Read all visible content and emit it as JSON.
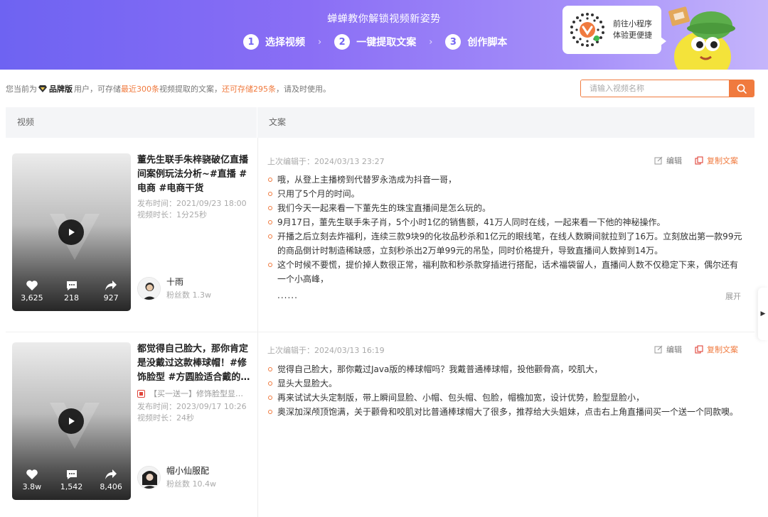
{
  "banner": {
    "title": "蝉蝉教你解锁视频新姿势",
    "steps": [
      {
        "num": "1",
        "label": "选择视频"
      },
      {
        "num": "2",
        "label": "一键提取文案"
      },
      {
        "num": "3",
        "label": "创作脚本"
      }
    ],
    "arrow": "›",
    "qr_line1": "前往小程序",
    "qr_line2": "体验更便捷",
    "accent": "#7566f3"
  },
  "info": {
    "prefix": "您当前为",
    "plan": "品牌版",
    "mid1": "用户，可存储",
    "quota": "最近300条",
    "mid2": "视频提取的文案，",
    "remaining": "还可存储295条",
    "suffix": "，请及时使用。",
    "highlight_color": "#f07a3e"
  },
  "search": {
    "placeholder": "请输入视频名称",
    "icon": "search-icon"
  },
  "table": {
    "col_video": "视频",
    "col_copy": "文案"
  },
  "rows": [
    {
      "title": "董先生联手朱梓骁破亿直播间案例玩法分析~#直播 #电商 #电商干货",
      "tag": "",
      "publish": "发布时间：2021/09/23 18:00",
      "duration": "视频时长：1分25秒",
      "likes": "3,625",
      "comments": "218",
      "shares": "927",
      "author": "十雨",
      "fans": "粉丝数 1.3w",
      "edited": "上次编辑于：2024/03/13 23:27",
      "edit_label": "编辑",
      "copy_label": "复制文案",
      "lines": [
        "哦，从登上主播榜到代替罗永浩成为抖音一哥，",
        "只用了5个月的时间。",
        "我们今天一起来看一下董先生的珠宝直播间是怎么玩的。",
        "9月17日，董先生联手朱子肖，5个小时1亿的销售额，41万人同时在线，一起来看一下他的神秘操作。",
        "开播之后立刻去炸福利，连续三款9块9的化妆品秒杀和1亿元的眼线笔，在线人数瞬间就拉到了16万。立刻放出第一款99元的商品倒计时制造稀缺感，立刻秒杀出2万单99元的吊坠，同时价格提升，导致直播间人数掉到14万。",
        "这个时候不要慌，提价掉人数很正常，福利款和秒杀款穿插进行搭配，话术福袋留人，直播间人数不仅稳定下来，偶尔还有一个小高峰，"
      ],
      "ellipsis": "......",
      "expand": "展开"
    },
    {
      "title": "都觉得自己脸大，那你肯定是没戴过这款棒球帽！#修饰脸型 #方圆脸适合戴的…",
      "tag": "【买一送一】修饰脸型显…",
      "publish": "发布时间：2023/09/17 10:26",
      "duration": "视频时长：24秒",
      "likes": "3.8w",
      "comments": "1,542",
      "shares": "8,406",
      "author": "帽小仙服配",
      "fans": "粉丝数 10.4w",
      "edited": "上次编辑于：2024/03/13 16:19",
      "edit_label": "编辑",
      "copy_label": "复制文案",
      "lines": [
        "觉得自己脸大，那你戴过Java版的棒球帽吗？我戴普通棒球帽，投他颧骨高，咬肌大，",
        "显头大显脸大。",
        "再来试试大头定制版，带上瞬间显脸、小帽、包头帽、包脸，帽檐加宽，设计优势，脸型显脸小，",
        "奥深加深颅顶饱满，关于颧骨和咬肌对比普通棒球帽大了很多，推荐给大头姐妹，点击右上角直播间买一个送一个同款噢。"
      ]
    }
  ]
}
